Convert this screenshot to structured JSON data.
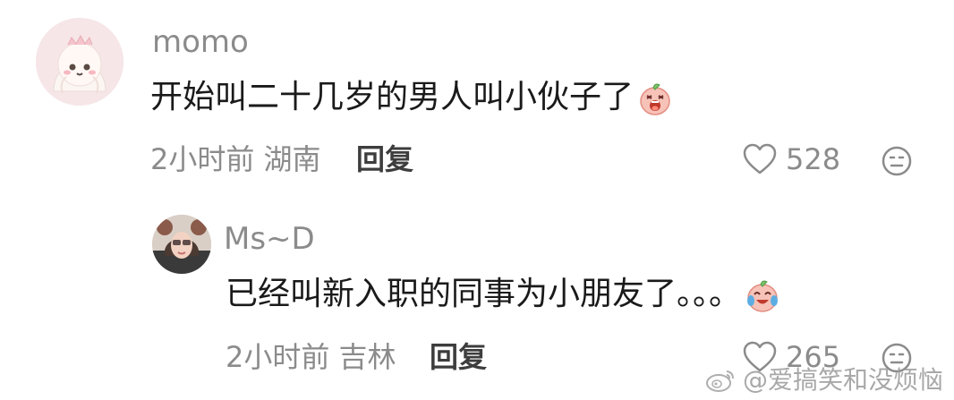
{
  "comments": [
    {
      "username": "momo",
      "text": "开始叫二十几岁的男人叫小伙子了",
      "emoji": "screaming-peach-emoji",
      "time": "2小时前",
      "location": "湖南",
      "reply_label": "回复",
      "likes": "528"
    },
    {
      "username": "Ms~D",
      "text": "已经叫新入职的同事为小朋友了。。。",
      "emoji": "crying-laughing-peach-emoji",
      "time": "2小时前",
      "location": "吉林",
      "reply_label": "回复",
      "likes": "265"
    }
  ],
  "icons": {
    "like": "heart-outline-icon",
    "dislike": "unhappy-face-icon"
  },
  "watermark": {
    "text": "@爱搞笑和没烦恼",
    "logo": "weibo-logo"
  },
  "colors": {
    "text_primary": "#1a1a1a",
    "text_secondary": "#8b8b8b",
    "reply": "#3d3d3d",
    "avatar1_bg": "#f6e6e8"
  }
}
